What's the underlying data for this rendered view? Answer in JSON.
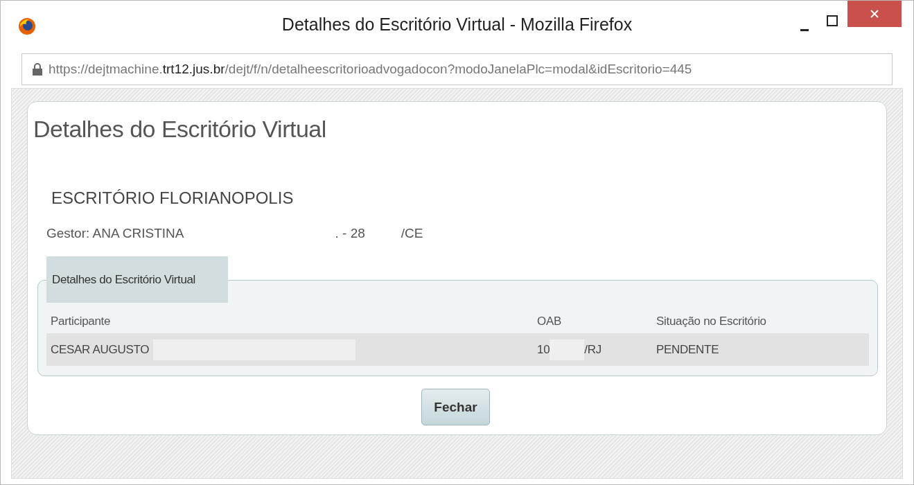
{
  "window": {
    "title": "Detalhes do Escritório Virtual - Mozilla Firefox"
  },
  "address_bar": {
    "url": "https://dejtmachine.**trt12.jus.br**/dejt/f/n/detalheescritorioadvogadocon?modoJanelaPlc=modal&idEscritorio=445"
  },
  "dialog": {
    "title": "Detalhes do Escritório Virtual",
    "office_name": "ESCRITÓRIO FLORIANOPOLIS",
    "manager": {
      "label": "Gestor: ANA CRISTINA",
      "number": ". - 28",
      "state": "/CE"
    },
    "fieldset": {
      "legend": "Detalhes do Escritório Virtual",
      "table": {
        "columns": [
          "Participante",
          "OAB",
          "Situação no Escritório"
        ],
        "rows": [
          {
            "participant": "CESAR AUGUSTO",
            "oab_prefix": "10",
            "oab_suffix": "/RJ",
            "status": "PENDENTE"
          }
        ]
      }
    },
    "buttons": [
      "Fechar"
    ]
  }
}
